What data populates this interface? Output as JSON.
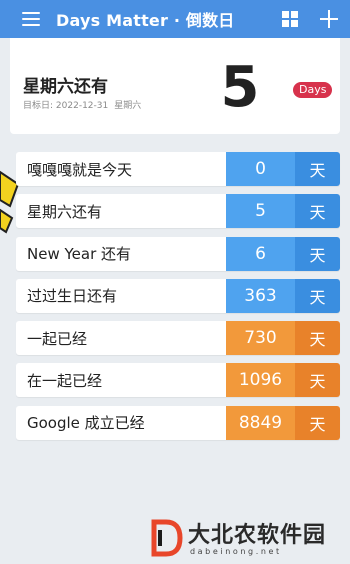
{
  "app_bar": {
    "title": "Days Matter · 倒数日",
    "menu_icon": "menu-icon",
    "grid_icon": "grid-icon",
    "add_icon": "plus-icon",
    "color": "#4a90e2"
  },
  "hero": {
    "title": "星期六还有",
    "target_label": "目标日:",
    "target_date": "2022-12-31",
    "target_weekday": "星期六",
    "number": "5",
    "badge": "Days",
    "badge_color": "#d7324c"
  },
  "events": [
    {
      "label": "嘎嘎嘎就是今天",
      "value": "0",
      "unit": "天",
      "kind": "future"
    },
    {
      "label": "星期六还有",
      "value": "5",
      "unit": "天",
      "kind": "future"
    },
    {
      "label": "New Year 还有",
      "value": "6",
      "unit": "天",
      "kind": "future"
    },
    {
      "label": "过过生日还有",
      "value": "363",
      "unit": "天",
      "kind": "future"
    },
    {
      "label": "一起已经",
      "value": "730",
      "unit": "天",
      "kind": "past"
    },
    {
      "label": "在一起已经",
      "value": "1096",
      "unit": "天",
      "kind": "past"
    },
    {
      "label": "Google 成立已经",
      "value": "8849",
      "unit": "天",
      "kind": "past"
    }
  ],
  "colors": {
    "future_value": "#4fa3ef",
    "future_unit": "#3a8ee0",
    "past_value": "#f2993b",
    "past_unit": "#e8822a"
  },
  "watermark": {
    "text": "大北农软件园",
    "domain": "dabeinong.net"
  }
}
